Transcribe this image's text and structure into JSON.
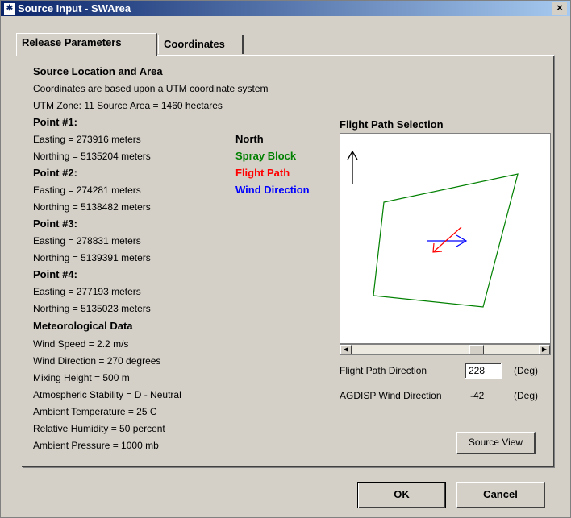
{
  "window": {
    "title": "Source Input - SWArea",
    "close_glyph": "×"
  },
  "tabs": [
    {
      "label": "Release Parameters",
      "active": true
    },
    {
      "label": "Coordinates",
      "active": false
    }
  ],
  "source": {
    "heading": "Source Location and Area",
    "coord_note": "Coordinates are based upon a UTM coordinate system",
    "zone_area": "UTM Zone: 11   Source Area = 1460 hectares",
    "points": [
      {
        "label": "Point #1:",
        "easting": "Easting = 273916 meters",
        "northing": "Northing = 5135204 meters"
      },
      {
        "label": "Point #2:",
        "easting": "Easting = 274281 meters",
        "northing": "Northing = 5138482 meters"
      },
      {
        "label": "Point #3:",
        "easting": "Easting = 278831 meters",
        "northing": "Northing = 5139391 meters"
      },
      {
        "label": "Point #4:",
        "easting": "Easting = 277193 meters",
        "northing": "Northing = 5135023 meters"
      }
    ]
  },
  "met": {
    "heading": "Meteorological  Data",
    "lines": [
      "Wind Speed = 2.2 m/s",
      "Wind Direction = 270 degrees",
      "Mixing Height = 500 m",
      "Atmospheric Stability = D - Neutral",
      "Ambient Temperature = 25 C",
      "Relative Humidity = 50 percent",
      "Ambient Pressure = 1000 mb"
    ]
  },
  "legend": [
    {
      "label": "North",
      "color": "#000000"
    },
    {
      "label": "Spray Block",
      "color": "#008000"
    },
    {
      "label": "Flight Path",
      "color": "#ff0000"
    },
    {
      "label": "Wind Direction",
      "color": "#0000ff"
    }
  ],
  "flight": {
    "title": "Flight Path Selection",
    "direction_label": "Flight Path Direction",
    "direction_value": "228",
    "unit": "(Deg)",
    "agdisp_label": "AGDISP Wind Direction",
    "agdisp_value": "-42",
    "agdisp_unit": "(Deg)",
    "scrollbar_position": 0.68
  },
  "buttons": {
    "source_view": "Source View",
    "ok_underline": "O",
    "ok_rest": "K",
    "cancel_underline": "C",
    "cancel_rest": "ancel"
  }
}
